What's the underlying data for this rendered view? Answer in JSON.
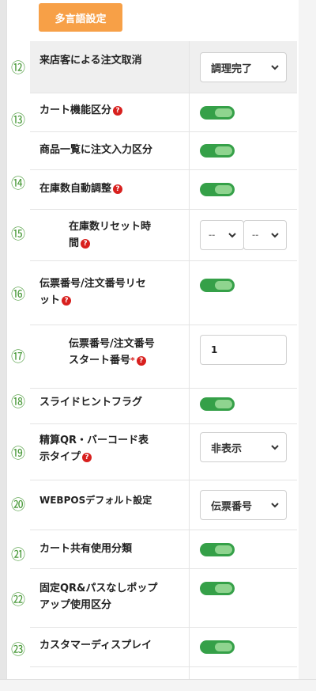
{
  "header": {
    "lang_button": "多言語設定"
  },
  "rows": [
    {
      "no": "⑫",
      "label": "来店客による注文取消",
      "select": "調理完了"
    },
    {
      "no": "⑬",
      "label": "カート機能区分"
    },
    {
      "no": "",
      "label": "商品一覧に注文入力区分"
    },
    {
      "no": "⑭",
      "label": "在庫数自動調整"
    },
    {
      "no": "⑮",
      "label_1": "在庫数リセット時",
      "label_2": "間",
      "select_a": "--",
      "select_b": "--"
    },
    {
      "no": "⑯",
      "label_1": "伝票番号/注文番号リセ",
      "label_2": "ット"
    },
    {
      "no": "⑰",
      "label_1": "伝票番号/注文番号",
      "label_2": "スタート番号",
      "required": "*",
      "input_value": "1"
    },
    {
      "no": "⑱",
      "label": "スライドヒントフラグ"
    },
    {
      "no": "⑲",
      "label_1": "精算QR・バーコード表",
      "label_2": "示タイプ",
      "select": "非表示"
    },
    {
      "no": "⑳",
      "label": "WEBPOSデフォルト設定",
      "select": "伝票番号"
    },
    {
      "no": "㉑",
      "label": "カート共有使用分類"
    },
    {
      "no": "㉒",
      "label_1": "固定QR&パスなしポップ",
      "label_2": "アップ使用区分"
    },
    {
      "no": "㉓",
      "label": "カスタマーディスプレイ"
    }
  ],
  "help_glyph": "?",
  "colors": {
    "toggle_on": "#35a048",
    "lang_button": "#f7a047",
    "help_icon": "#d8201e",
    "row_number": "#4a9a3a"
  }
}
